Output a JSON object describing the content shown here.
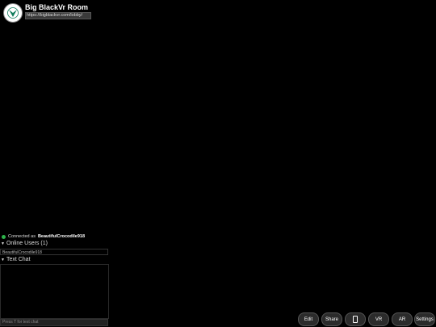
{
  "room": {
    "title": "Big BlackVr Room",
    "url": "https://bigblackvr.com/lobby/"
  },
  "status": {
    "prefix": "Connected as",
    "username": "BeautifulCrocodile918",
    "color": "#2db34a"
  },
  "online_users": {
    "header": "Online Users (1)",
    "users": [
      "BeautifulCrocodile918"
    ]
  },
  "text_chat": {
    "header": "Text Chat",
    "input_placeholder": "Press T for text chat"
  },
  "toolbar": {
    "edit": "Edit",
    "share": "Share",
    "phone_icon": "phone-icon",
    "vr": "VR",
    "ar": "AR",
    "settings": "Settings"
  }
}
